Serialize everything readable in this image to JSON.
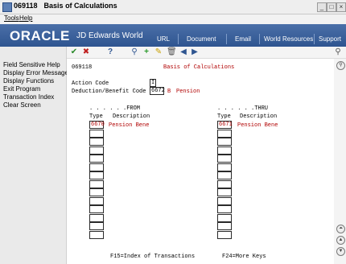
{
  "window": {
    "program_id": "069118",
    "title": "Basis of Calculations"
  },
  "menu": {
    "tools": "Tools",
    "help": "Help"
  },
  "banner": {
    "logo": "ORACLE",
    "product": "JD Edwards World",
    "nav": [
      "URL",
      "Document",
      "Email",
      "World Resources",
      "Support"
    ]
  },
  "sidebar": {
    "items": [
      "Field Sensitive Help",
      "Display Error Message",
      "Display Functions",
      "Exit Program",
      "Transaction Index",
      "Clear Screen"
    ]
  },
  "toolbar": {
    "icons": [
      "check-icon",
      "cancel-icon",
      "help-icon",
      "binoculars-icon",
      "add-icon",
      "edit-icon",
      "delete-icon",
      "previous-icon",
      "next-icon",
      "search-icon"
    ]
  },
  "form": {
    "program_id": "069118",
    "screen_title": "Basis of Calculations",
    "action_code_label": "Action Code",
    "action_code_value": "I",
    "deduction_label": "Deduction/Benefit Code",
    "deduction_value": "6672",
    "deduction_type": "B",
    "deduction_desc": "Pension",
    "from_header": ". . . . . .FROM",
    "thru_header": ". . . . . .THRU",
    "type_col": "Type",
    "desc_col": "Description",
    "from_rows": [
      {
        "type": "6670",
        "desc": "Pension Bene"
      },
      {
        "type": "",
        "desc": ""
      },
      {
        "type": "",
        "desc": ""
      },
      {
        "type": "",
        "desc": ""
      },
      {
        "type": "",
        "desc": ""
      },
      {
        "type": "",
        "desc": ""
      },
      {
        "type": "",
        "desc": ""
      },
      {
        "type": "",
        "desc": ""
      },
      {
        "type": "",
        "desc": ""
      },
      {
        "type": "",
        "desc": ""
      },
      {
        "type": "",
        "desc": ""
      },
      {
        "type": "",
        "desc": ""
      },
      {
        "type": "",
        "desc": ""
      },
      {
        "type": "",
        "desc": ""
      }
    ],
    "thru_rows": [
      {
        "type": "6671",
        "desc": "Pension Bene"
      },
      {
        "type": "",
        "desc": ""
      },
      {
        "type": "",
        "desc": ""
      },
      {
        "type": "",
        "desc": ""
      },
      {
        "type": "",
        "desc": ""
      },
      {
        "type": "",
        "desc": ""
      },
      {
        "type": "",
        "desc": ""
      },
      {
        "type": "",
        "desc": ""
      },
      {
        "type": "",
        "desc": ""
      },
      {
        "type": "",
        "desc": ""
      },
      {
        "type": "",
        "desc": ""
      },
      {
        "type": "",
        "desc": ""
      },
      {
        "type": "",
        "desc": ""
      },
      {
        "type": "",
        "desc": ""
      }
    ],
    "f15": "F15=Index of Transactions",
    "f24": "F24=More Keys"
  },
  "colors": {
    "accent": "#2f5590",
    "field_text": "#b00000"
  }
}
